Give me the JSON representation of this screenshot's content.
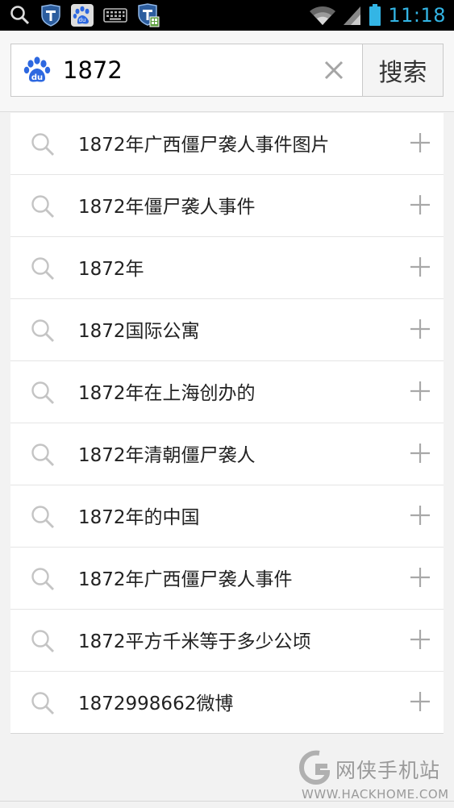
{
  "status_bar": {
    "time": "11:18",
    "icons": [
      "search-icon",
      "shield-t-icon",
      "baidu-icon",
      "keyboard-icon",
      "shield-t-icon",
      "wifi-icon",
      "signal-icon",
      "battery-icon"
    ]
  },
  "search": {
    "query": "1872",
    "button_label": "搜索"
  },
  "suggestions": [
    {
      "text": "1872年广西僵尸袭人事件图片"
    },
    {
      "text": "1872年僵尸袭人事件"
    },
    {
      "text": "1872年"
    },
    {
      "text": "1872国际公寓"
    },
    {
      "text": "1872年在上海创办的"
    },
    {
      "text": "1872年清朝僵尸袭人"
    },
    {
      "text": "1872年的中国"
    },
    {
      "text": "1872年广西僵尸袭人事件"
    },
    {
      "text": "1872平方千米等于多少公顷"
    },
    {
      "text": "1872998662微博"
    }
  ],
  "watermark": {
    "cn": "网侠手机站",
    "en": "WWW.HACKHOME.COM"
  },
  "colors": {
    "status_accent": "#33b5e5",
    "baidu_blue": "#2d68e0",
    "icon_gray": "#b5b5b5"
  }
}
